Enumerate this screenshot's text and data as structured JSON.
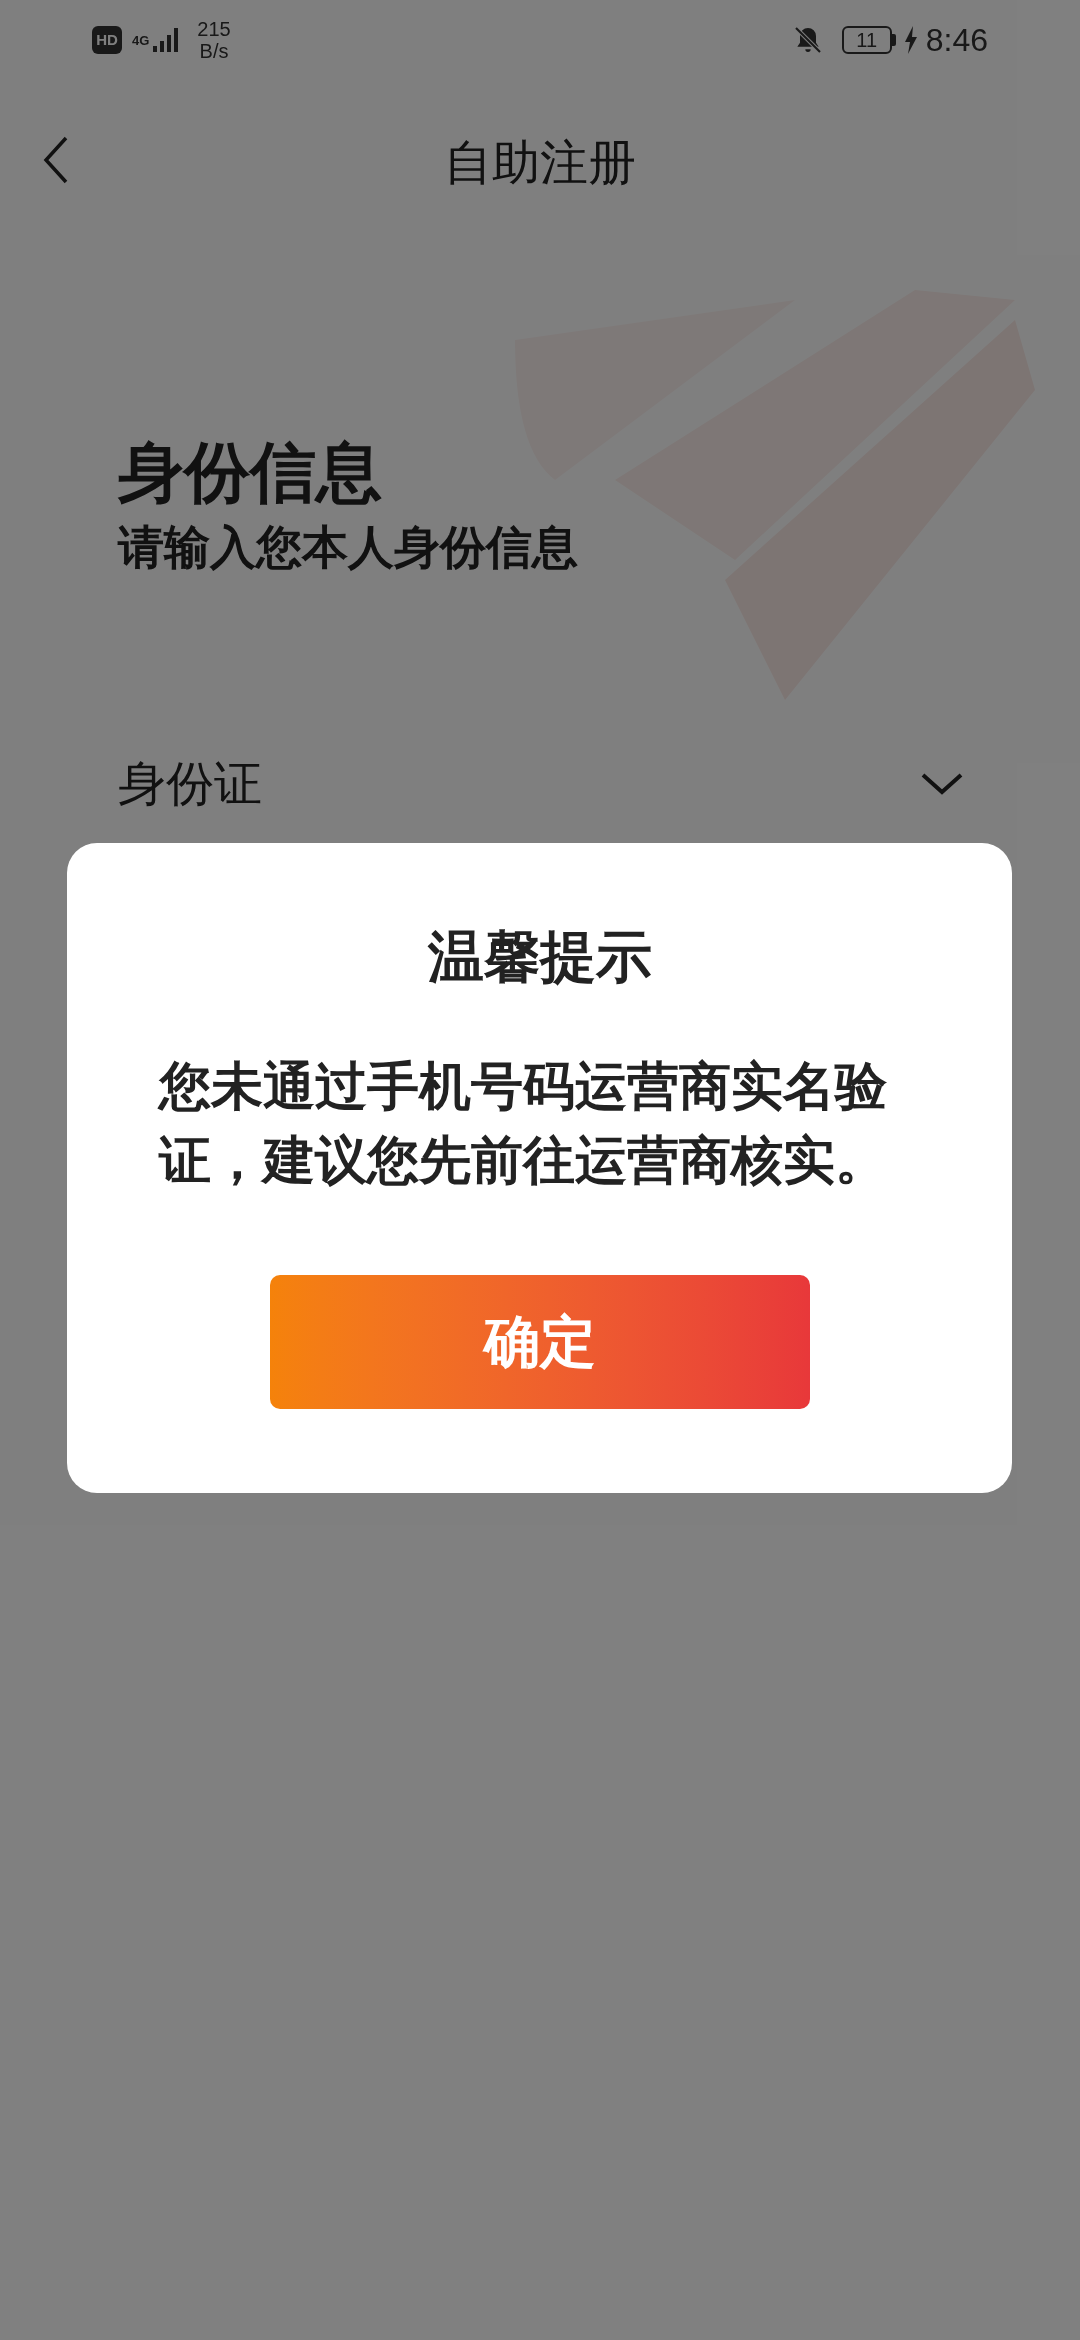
{
  "status_bar": {
    "hd_label": "HD",
    "network_type": "4G",
    "speed_value": "215",
    "speed_unit": "B/s",
    "battery": "11",
    "time": "8:46"
  },
  "header": {
    "title": "自助注册"
  },
  "section": {
    "title": "身份信息",
    "subtitle": "请输入您本人身份信息"
  },
  "id_type": {
    "value": "身份证"
  },
  "dialog": {
    "title": "温馨提示",
    "message": "您未通过手机号码运营商实名验证，建议您先前往运营商核实。",
    "button": "确定"
  }
}
